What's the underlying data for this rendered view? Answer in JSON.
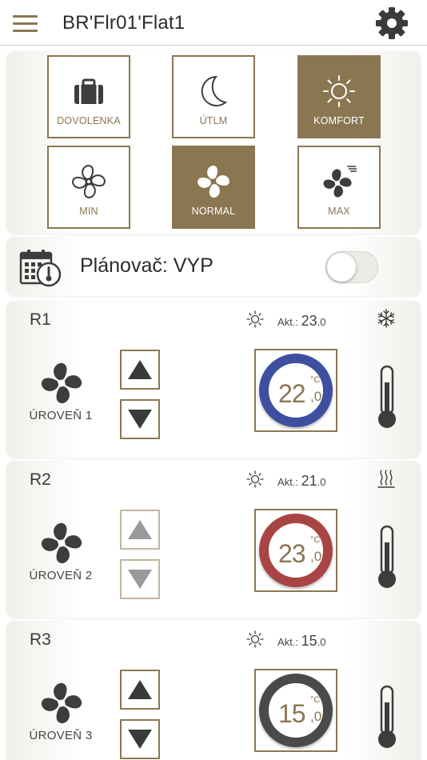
{
  "header": {
    "title": "BR'Flr01'Flat1"
  },
  "modes": [
    {
      "id": "dovolenka",
      "label": "DOVOLENKA",
      "icon": "suitcase-icon",
      "active": false
    },
    {
      "id": "utlm",
      "label": "ÚTLM",
      "icon": "moon-icon",
      "active": false
    },
    {
      "id": "komfort",
      "label": "KOMFORT",
      "icon": "sun-icon",
      "active": true
    },
    {
      "id": "min",
      "label": "MIN",
      "icon": "fan-outline-icon",
      "active": false
    },
    {
      "id": "normal",
      "label": "NORMAL",
      "icon": "fan-icon",
      "active": true
    },
    {
      "id": "max",
      "label": "MAX",
      "icon": "fan-fast-icon",
      "active": false
    }
  ],
  "scheduler": {
    "label": "Plánovač: VYP",
    "enabled": false
  },
  "rooms": [
    {
      "name": "R1",
      "akt_label": "Akt.:",
      "actual_int": "23",
      "actual_dec": ".0",
      "status_icon": "snowflake-icon",
      "fan_level": "ÚROVEŇ 1",
      "setpoint_int": "22",
      "setpoint_unit": "°C",
      "setpoint_dec": ",0",
      "ring_color": "#3f4fa0",
      "arrows_enabled": true
    },
    {
      "name": "R2",
      "akt_label": "Akt.:",
      "actual_int": "21",
      "actual_dec": ".0",
      "status_icon": "heating-icon",
      "fan_level": "ÚROVEŇ 2",
      "setpoint_int": "23",
      "setpoint_unit": "°C",
      "setpoint_dec": ",0",
      "ring_color": "#a94444",
      "arrows_enabled": false
    },
    {
      "name": "R3",
      "akt_label": "Akt.:",
      "actual_int": "15",
      "actual_dec": ".0",
      "status_icon": "",
      "fan_level": "ÚROVEŇ 3",
      "setpoint_int": "15",
      "setpoint_unit": "°C",
      "setpoint_dec": ",0",
      "ring_color": "#4a4a4a",
      "arrows_enabled": true
    }
  ],
  "colors": {
    "accent": "#8a7751",
    "icon_dark": "#3d3d3d",
    "disabled_arrow": "#999999"
  }
}
